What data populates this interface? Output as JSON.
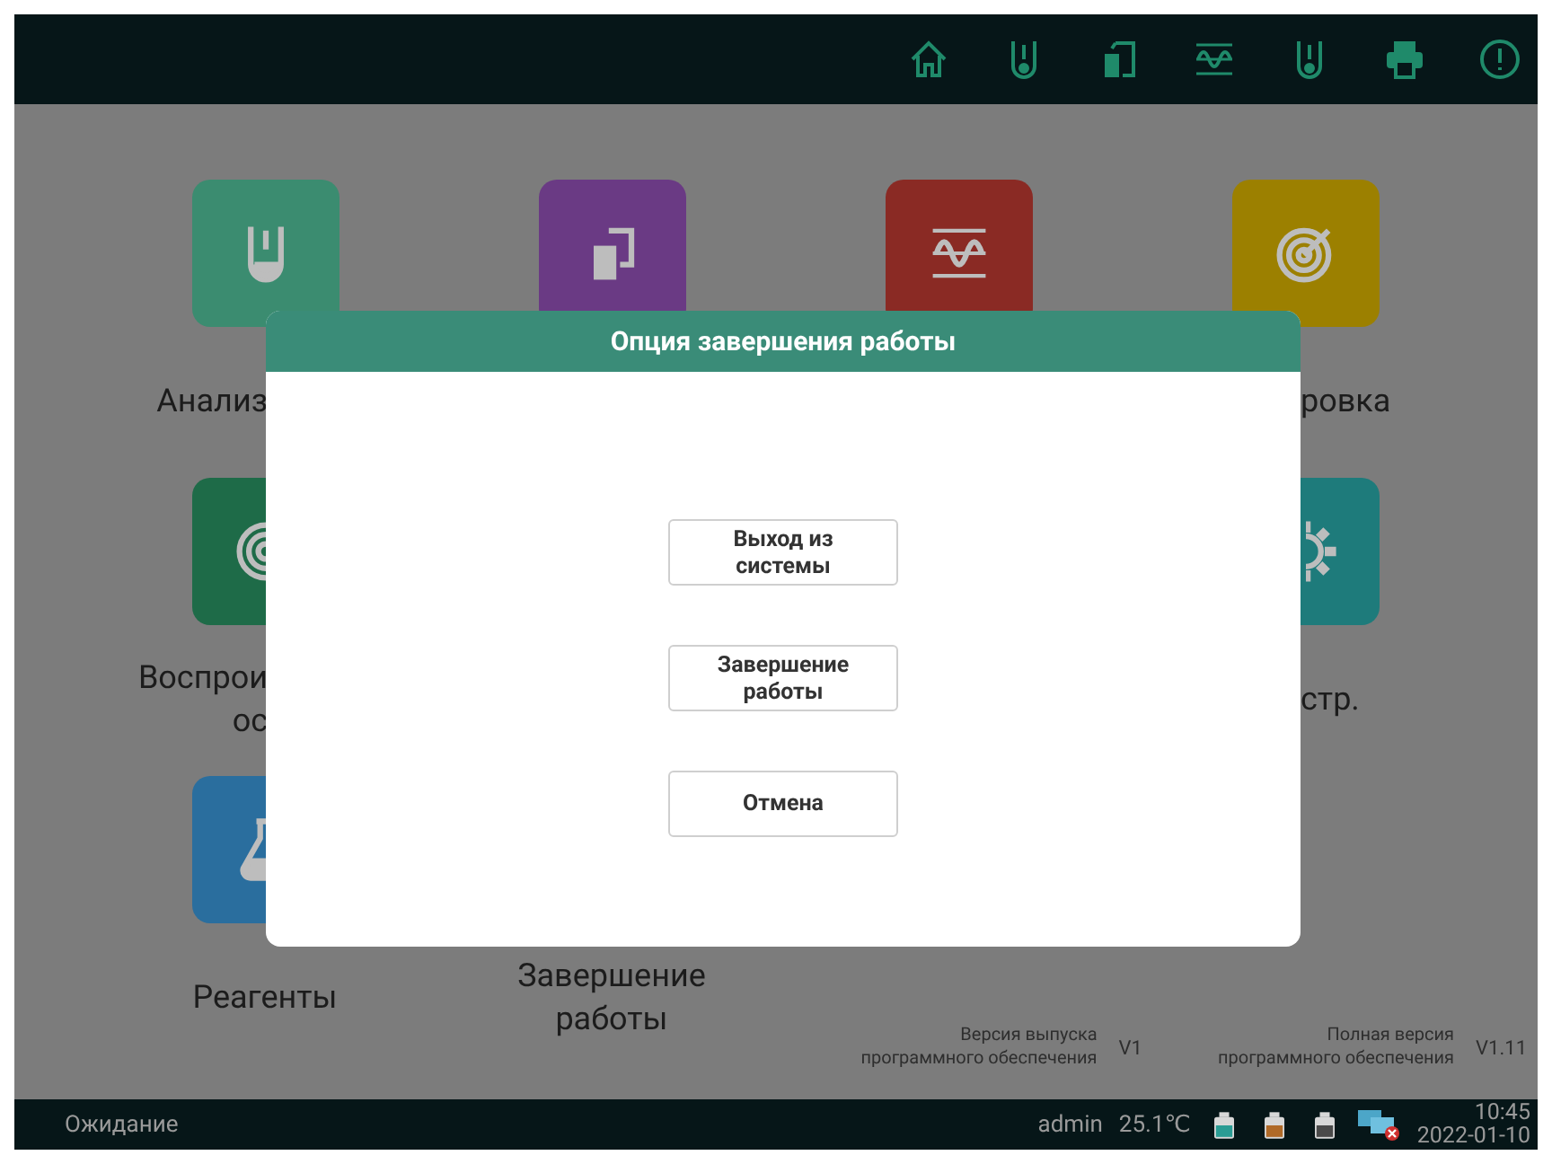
{
  "top_bar": {
    "icons": [
      {
        "kind": "home"
      },
      {
        "kind": "tube"
      },
      {
        "kind": "document"
      },
      {
        "kind": "wave"
      },
      {
        "kind": "tube"
      },
      {
        "kind": "printer"
      },
      {
        "kind": "alert"
      }
    ]
  },
  "tiles": [
    {
      "color": "#3b8c70",
      "label": "Анализ"
    },
    {
      "color": "#6a3a84"
    },
    {
      "color": "#8a2a24"
    },
    {
      "color": "#9c8000",
      "label": "ровка"
    },
    {
      "color": "#1e6b48",
      "label": "Воспрои\nос"
    },
    {
      "color": "#1e7b7b",
      "label": "стр."
    },
    {
      "color": "#2a6e9e",
      "label": "Реагенты"
    },
    {
      "label": "Завершение\nработы"
    }
  ],
  "versions": [
    {
      "label": "Версия выпуска\nпрограммного обеспечения",
      "value": "V1"
    },
    {
      "label": "Полная версия\nпрограммного обеспечения",
      "value": "V1.11"
    }
  ],
  "dialog": {
    "title": "Опция завершения работы",
    "buttons": [
      "Выход из\nсистемы",
      "Завершение\nработы",
      "Отмена"
    ]
  },
  "status_bar": {
    "status": "Ожидание",
    "user": "admin",
    "temperature": "25.1℃",
    "bottles": [
      {
        "color": "#2a9c94"
      },
      {
        "color": "#b06a28"
      },
      {
        "color": "#4a4a4a"
      }
    ],
    "network_error": true,
    "time": "10:45",
    "date": "2022-01-10"
  }
}
